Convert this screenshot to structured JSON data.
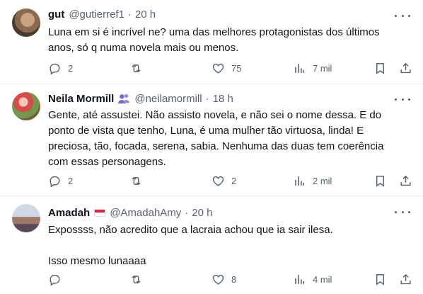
{
  "tweets": [
    {
      "name": "gut",
      "handle": "@gutierref1",
      "separator": "·",
      "time": "20 h",
      "text": "Luna em si é incrível ne? uma das melhores protagonistas dos últimos\nanos, só q numa novela mais ou menos.",
      "replies": "2",
      "retweets": "",
      "likes": "75",
      "views": "7 mil"
    },
    {
      "name": "Neila Mormill",
      "handle": "@neilamormill",
      "separator": "·",
      "time": "18 h",
      "text": "Gente, até assustei. Não assisto novela, e não sei o nome dessa. E do\nponto de vista que tenho, Luna, é uma mulher tão virtuosa, linda! E\npreciosa, tão, focada, serena, sabia. Nenhuma das duas tem coerência\ncom essas personagens.",
      "replies": "2",
      "retweets": "",
      "likes": "2",
      "views": "2 mil"
    },
    {
      "name": "Amadah",
      "handle": "@AmadahAmy",
      "separator": "·",
      "time": "20 h",
      "text": "Expossss, não acredito que a lacraia achou que ia sair ilesa.\n\nIsso mesmo lunaaaa",
      "replies": "",
      "retweets": "",
      "likes": "8",
      "views": "4 mil"
    }
  ],
  "colors": {
    "text": "#0f1419",
    "secondary": "#536471",
    "divider": "#eff3f4",
    "verified_badge": "#7a68c9"
  },
  "icons": [
    "reply-icon",
    "retweet-icon",
    "like-icon",
    "views-icon",
    "bookmark-icon",
    "share-icon",
    "more-icon",
    "verified-badge-icon",
    "flag-icon"
  ]
}
